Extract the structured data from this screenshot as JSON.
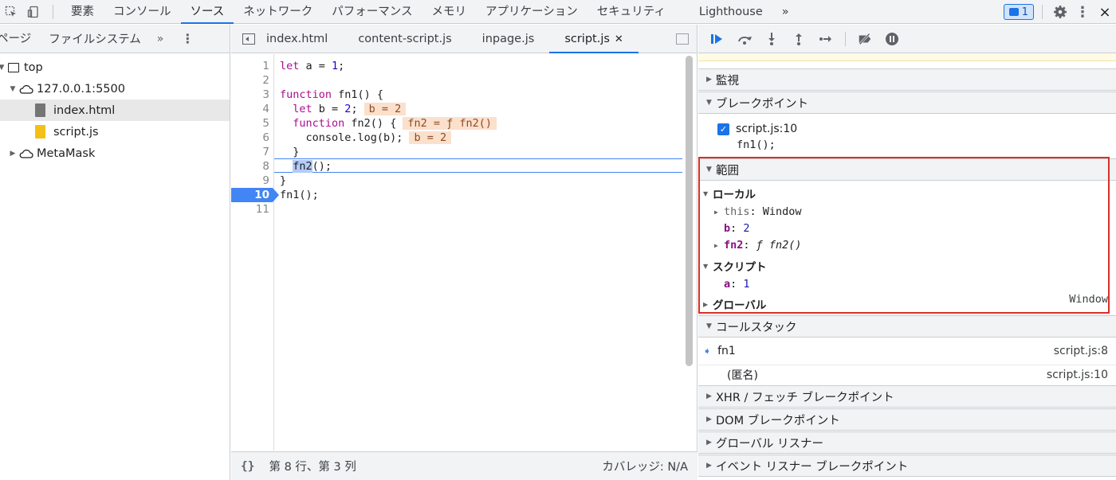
{
  "topbar": {
    "tabs": [
      "要素",
      "コンソール",
      "ソース",
      "ネットワーク",
      "パフォーマンス",
      "メモリ",
      "アプリケーション",
      "セキュリティ",
      "Lighthouse"
    ],
    "active_tab": "ソース",
    "more": "»",
    "issues_count": "1",
    "close": "×"
  },
  "navigator": {
    "tabs": [
      "ページ",
      "ファイルシステム"
    ],
    "more": "»",
    "tree": {
      "top": "top",
      "origin": "127.0.0.1:5500",
      "file1": "index.html",
      "file2": "script.js",
      "ext": "MetaMask"
    }
  },
  "editor": {
    "tabs": [
      "index.html",
      "content-script.js",
      "inpage.js",
      "script.js"
    ],
    "active_tab": "script.js",
    "line_numbers": [
      "1",
      "2",
      "3",
      "4",
      "5",
      "6",
      "7",
      "8",
      "9",
      "10",
      "11"
    ],
    "code": {
      "l1_kw": "let",
      "l1_rest": " a = ",
      "l1_num": "1",
      "l1_end": ";",
      "l3_kw": "function",
      "l3_rest": " fn1() {",
      "l4_kw": "let",
      "l4_rest": " b = ",
      "l4_num": "2",
      "l4_end": ";",
      "l4_inline": "b = 2",
      "l5_kw": "function",
      "l5_rest": " fn2() {",
      "l5_inline": "fn2 = ƒ fn2()",
      "l6_rest": "    console.log(b);",
      "l6_inline": "b = 2",
      "l7": "  }",
      "l8_fn": "fn2",
      "l8_rest": "();",
      "l9": "}",
      "l10": "fn1();"
    },
    "status": {
      "position": "第 8 行、第 3 列",
      "coverage": "カバレッジ: N/A"
    }
  },
  "sidebar": {
    "sections": {
      "watch": "監視",
      "breakpoints": "ブレークポイント",
      "scope": "範囲",
      "callstack": "コールスタック",
      "xhr": "XHR / フェッチ ブレークポイント",
      "dom": "DOM ブレークポイント",
      "global_listeners": "グローバル リスナー",
      "event_listeners": "イベント リスナー ブレークポイント"
    },
    "breakpoint": {
      "location": "script.js:10",
      "code": "fn1();"
    },
    "scope": {
      "local_label": "ローカル",
      "this_name": "this",
      "this_value": "Window",
      "b_name": "b",
      "b_value": "2",
      "fn2_name": "fn2",
      "fn2_value": "ƒ fn2()",
      "script_label": "スクリプト",
      "a_name": "a",
      "a_value": "1",
      "global_label": "グローバル",
      "global_value": "Window"
    },
    "callstack": [
      {
        "name": "fn1",
        "location": "script.js:8"
      },
      {
        "name": "(匿名)",
        "location": "script.js:10"
      }
    ]
  }
}
